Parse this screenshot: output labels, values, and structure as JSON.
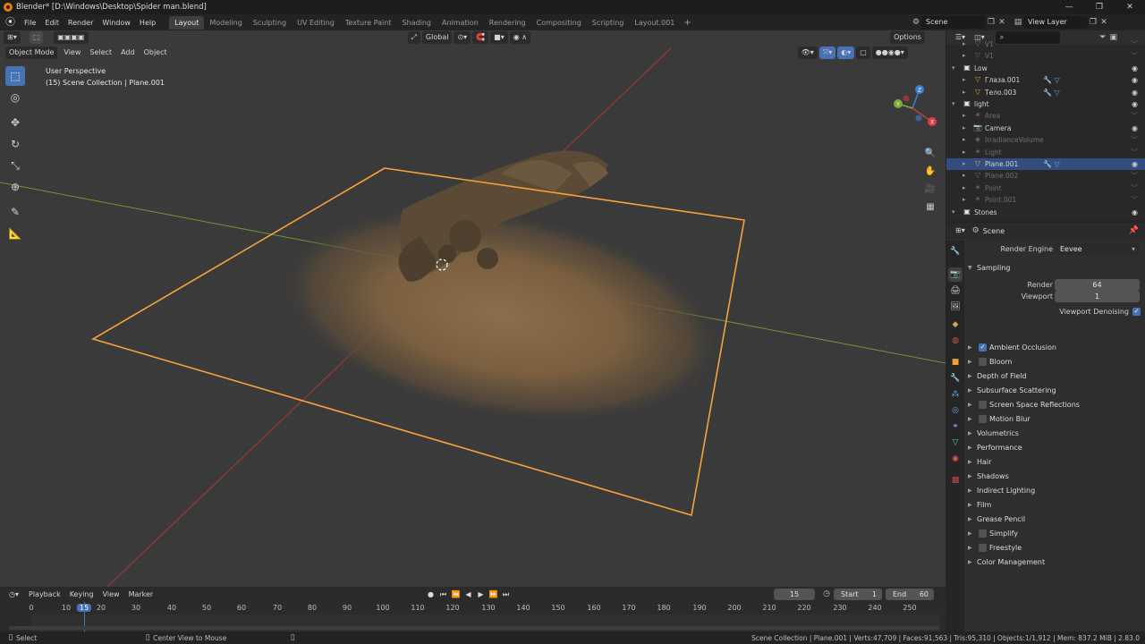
{
  "window": {
    "title": "Blender* [D:\\Windows\\Desktop\\Spider man.blend]",
    "buttons": [
      "—",
      "❐",
      "✕"
    ]
  },
  "menu": [
    "File",
    "Edit",
    "Render",
    "Window",
    "Help"
  ],
  "workspaces": [
    {
      "label": "Layout",
      "active": true
    },
    {
      "label": "Modeling"
    },
    {
      "label": "Sculpting"
    },
    {
      "label": "UV Editing"
    },
    {
      "label": "Texture Paint"
    },
    {
      "label": "Shading"
    },
    {
      "label": "Animation"
    },
    {
      "label": "Rendering"
    },
    {
      "label": "Compositing"
    },
    {
      "label": "Scripting"
    },
    {
      "label": "Layout.001"
    }
  ],
  "workspace_add": "+",
  "scene_selector": {
    "value": "Scene"
  },
  "view_layer_selector": {
    "value": "View Layer"
  },
  "viewport": {
    "transform_orientation": "Global",
    "options_label": "Options",
    "mode": "Object Mode",
    "header_menus": [
      "View",
      "Select",
      "Add",
      "Object"
    ],
    "info_line1": "User Perspective",
    "info_line2": "(15) Scene Collection | Plane.001",
    "gizmo_axes": [
      "X",
      "Y",
      "Z"
    ]
  },
  "outliner": {
    "search_placeholder": "",
    "rows": [
      {
        "name": "V1",
        "depth": 2,
        "icon": "object",
        "dim": true
      },
      {
        "name": "V1",
        "depth": 2,
        "icon": "object",
        "dim": true
      },
      {
        "name": "Low",
        "depth": 1,
        "icon": "collection",
        "expanded": true
      },
      {
        "name": "Глаза.001",
        "depth": 2,
        "icon": "mesh"
      },
      {
        "name": "Тело.003",
        "depth": 2,
        "icon": "mesh"
      },
      {
        "name": "light",
        "depth": 1,
        "icon": "collection",
        "expanded": true
      },
      {
        "name": "Area",
        "depth": 2,
        "icon": "light",
        "dim": true
      },
      {
        "name": "Camera",
        "depth": 2,
        "icon": "camera"
      },
      {
        "name": "IrradianceVolume",
        "depth": 2,
        "icon": "probe",
        "dim": true
      },
      {
        "name": "Light",
        "depth": 2,
        "icon": "light",
        "dim": true
      },
      {
        "name": "Plane.001",
        "depth": 2,
        "icon": "mesh",
        "selected": true
      },
      {
        "name": "Plane.002",
        "depth": 2,
        "icon": "mesh",
        "dim": true
      },
      {
        "name": "Point",
        "depth": 2,
        "icon": "light",
        "dim": true
      },
      {
        "name": "Point.001",
        "depth": 2,
        "icon": "light",
        "dim": true
      },
      {
        "name": "Stones",
        "depth": 1,
        "icon": "collection",
        "expanded": true
      }
    ]
  },
  "properties": {
    "context": "Scene",
    "render_engine_label": "Render Engine",
    "render_engine_value": "Eevee",
    "sampling": {
      "title": "Sampling",
      "render_label": "Render",
      "render_value": "64",
      "viewport_label": "Viewport",
      "viewport_value": "1",
      "denoise_label": "Viewport Denoising",
      "denoise_checked": true
    },
    "panels": [
      {
        "label": "Ambient Occlusion",
        "checkbox": true,
        "checked": true
      },
      {
        "label": "Bloom",
        "checkbox": true,
        "checked": false
      },
      {
        "label": "Depth of Field"
      },
      {
        "label": "Subsurface Scattering"
      },
      {
        "label": "Screen Space Reflections",
        "checkbox": true,
        "checked": false
      },
      {
        "label": "Motion Blur",
        "checkbox": true,
        "checked": false
      },
      {
        "label": "Volumetrics"
      },
      {
        "label": "Performance"
      },
      {
        "label": "Hair"
      },
      {
        "label": "Shadows"
      },
      {
        "label": "Indirect Lighting"
      },
      {
        "label": "Film"
      },
      {
        "label": "Grease Pencil"
      },
      {
        "label": "Simplify",
        "checkbox": true,
        "checked": false
      },
      {
        "label": "Freestyle",
        "checkbox": true,
        "checked": false
      },
      {
        "label": "Color Management"
      }
    ]
  },
  "timeline": {
    "menus": [
      "Playback",
      "Keying",
      "View",
      "Marker"
    ],
    "current_frame": "15",
    "start_label": "Start",
    "start_value": "1",
    "end_label": "End",
    "end_value": "60",
    "ruler": [
      "0",
      "10",
      "15",
      "20",
      "30",
      "40",
      "50",
      "60",
      "70",
      "80",
      "90",
      "100",
      "110",
      "120",
      "130",
      "140",
      "150",
      "160",
      "170",
      "180",
      "190",
      "200",
      "210",
      "220",
      "230",
      "240",
      "250"
    ]
  },
  "statusbar": {
    "left": "Select",
    "middle": "Center View to Mouse",
    "right": "Scene Collection | Plane.001 | Verts:47,709 | Faces:91,563 | Tris:95,310 | Objects:1/1,912 | Mem: 837.2 MiB | 2.83.0"
  },
  "colors": {
    "accent": "#4772b3",
    "selection_outline": "#f7a23a",
    "axis_x": "#c33b3b",
    "axis_y": "#7dab3a",
    "outliner_selected": "#334d80"
  }
}
